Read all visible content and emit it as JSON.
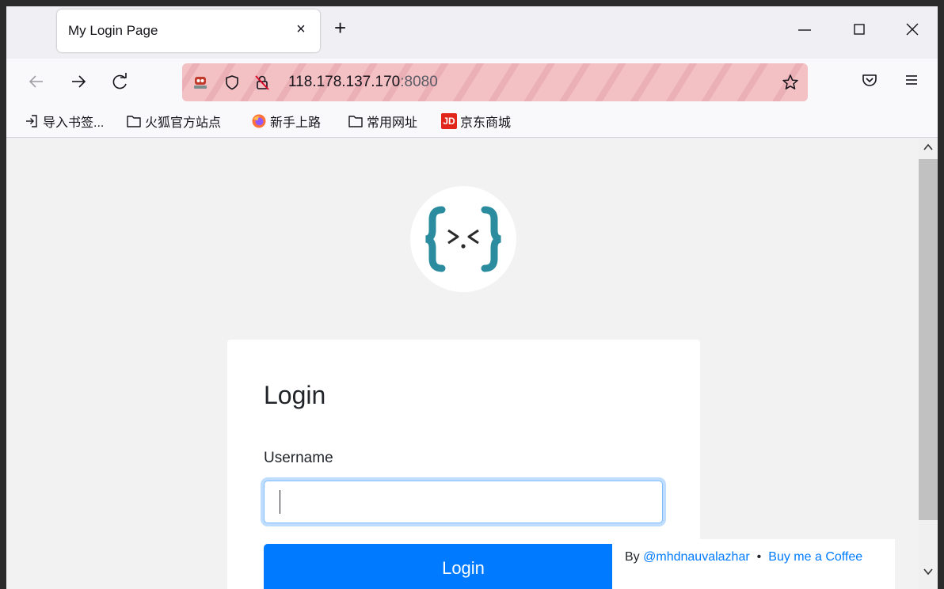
{
  "tab": {
    "title": "My Login Page",
    "close_glyph": "×",
    "new_tab_glyph": "+"
  },
  "nav": {
    "url_host": "118.178.137.170",
    "url_port": ":8080"
  },
  "bookmarks": [
    {
      "label": "导入书签...",
      "icon": "import-icon"
    },
    {
      "label": "火狐官方站点",
      "icon": "folder-icon"
    },
    {
      "label": "新手上路",
      "icon": "firefox-icon"
    },
    {
      "label": "常用网址",
      "icon": "folder-icon"
    },
    {
      "label": "京东商城",
      "icon": "jd-icon",
      "badge": "JD"
    }
  ],
  "page": {
    "logo_text": "{>.<}",
    "card_title": "Login",
    "username_label": "Username",
    "username_value": "",
    "login_button": "Login"
  },
  "credit": {
    "by": "By",
    "author": "@mhdnauvalazhar",
    "separator": "•",
    "coffee": "Buy me a Coffee"
  },
  "colors": {
    "primary": "#007bff",
    "logo_teal": "#2a8c9e",
    "url_warning_stripe": "#f3c0c4"
  }
}
